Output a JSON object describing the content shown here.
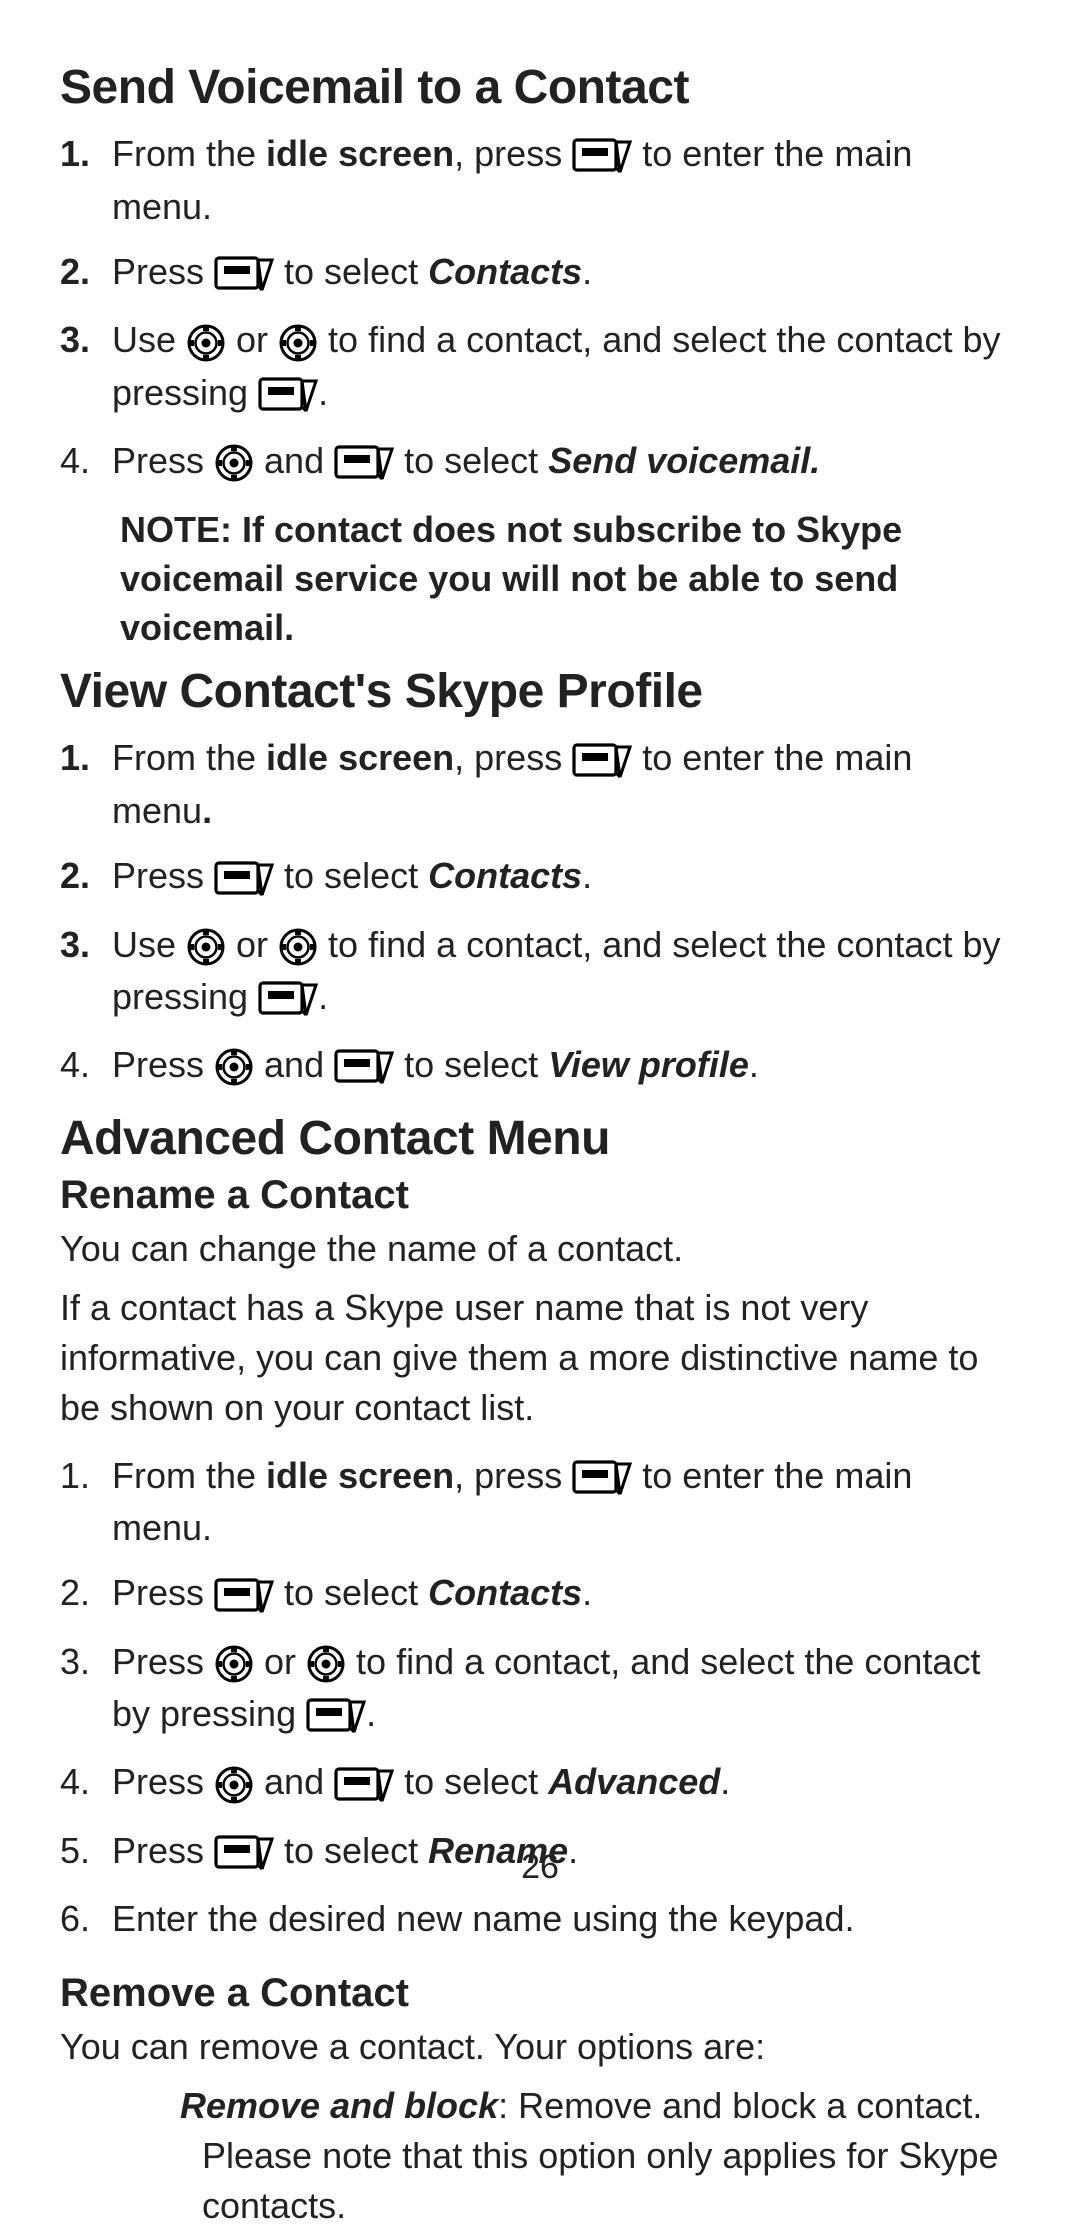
{
  "page_number": "26",
  "s1": {
    "title": "Send Voicemail to a Contact",
    "step1_a": "From the ",
    "step1_b": "idle screen",
    "step1_c": ", press ",
    "step1_d": " to enter the main menu.",
    "step2_a": "Press ",
    "step2_b": " to select ",
    "step2_c": "Contacts",
    "step2_d": ".",
    "step3_a": "Use ",
    "step3_b": " or ",
    "step3_c": " to find a contact, and select the contact by pressing ",
    "step3_d": ".",
    "step4_a": "Press ",
    "step4_b": " and ",
    "step4_c": " to select ",
    "step4_d": "Send voicemail.",
    "note": "NOTE: If contact does not subscribe to Skype voicemail service you will not be able to send voicemail."
  },
  "s2": {
    "title": "View Contact's Skype Profile",
    "step1_a": "From the ",
    "step1_b": "idle screen",
    "step1_c": ", press ",
    "step1_d": " to enter the main menu",
    "step1_e": ".",
    "step2_a": "Press ",
    "step2_b": " to select ",
    "step2_c": "Contacts",
    "step2_d": ".",
    "step3_a": "Use ",
    "step3_b": " or ",
    "step3_c": " to find a contact, and select the contact by pressing ",
    "step3_d": ".",
    "step4_a": "Press ",
    "step4_b": " and ",
    "step4_c": " to select ",
    "step4_d": "View profile",
    "step4_e": "."
  },
  "s3": {
    "title": "Advanced Contact Menu",
    "sub1": "Rename a Contact",
    "p1": "You can change the name of a contact.",
    "p2": "If a contact has a Skype user name that is not very informative, you can give them a more distinctive name to be shown on your contact list.",
    "step1_a": "From the ",
    "step1_b": "idle screen",
    "step1_c": ", press ",
    "step1_d": " to enter the main menu.",
    "step2_a": "Press ",
    "step2_b": " to select ",
    "step2_c": "Contacts",
    "step2_d": ".",
    "step3_a": "Press ",
    "step3_b": " or ",
    "step3_c": " to find a contact, and select the contact by pressing ",
    "step3_d": ".",
    "step4_a": "Press ",
    "step4_b": " and ",
    "step4_c": " to select ",
    "step4_d": "Advanced",
    "step4_e": ".",
    "step5_a": "Press ",
    "step5_b": " to select ",
    "step5_c": "Rename",
    "step5_d": ".",
    "step6": "Enter the desired new name using the keypad.",
    "sub2": "Remove a Contact",
    "p3": "You can remove a contact. Your options are:",
    "opt1_a": "Remove and block",
    "opt1_b": ": Remove and block a contact. Please note that this option only applies for Skype contacts."
  },
  "nums": {
    "n1b": "1.",
    "n2b": "2.",
    "n3b": "3.",
    "n1": "1.",
    "n2": "2.",
    "n3": "3.",
    "n4": "4.",
    "n5": "5.",
    "n6": "6."
  }
}
